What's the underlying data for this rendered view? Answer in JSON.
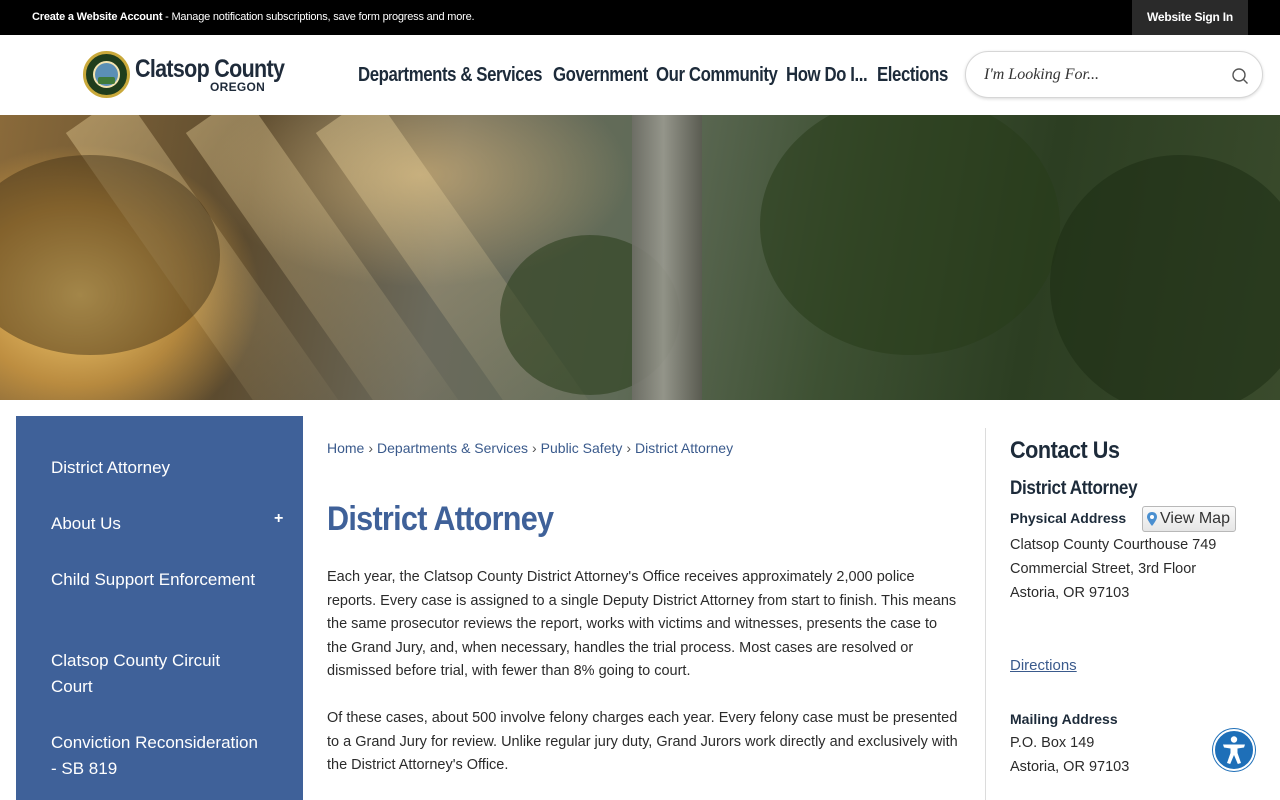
{
  "topbar": {
    "create_account": "Create a Website Account",
    "create_account_desc": " - Manage notification subscriptions, save form progress and more.",
    "sign_in": "Website Sign In"
  },
  "header": {
    "logo_name": "Clatsop County",
    "logo_sub": "OREGON",
    "nav": [
      "Departments & Services",
      "Government",
      "Our Community",
      "How Do I...",
      "Elections"
    ],
    "search_placeholder": "I'm Looking For..."
  },
  "sidebar": {
    "items": [
      "District Attorney",
      "About Us",
      "Child Support Enforcement",
      "Clatsop County Circuit Court",
      "Conviction Reconsideration - SB 819"
    ],
    "toggle": "+"
  },
  "breadcrumb": [
    "Home",
    "Departments & Services",
    "Public Safety",
    "District Attorney"
  ],
  "breadcrumb_sep": "›",
  "main": {
    "title": "District Attorney",
    "paragraphs": [
      "Each year, the Clatsop County District Attorney's Office receives approximately 2,000 police reports. Every case is assigned to a single Deputy District Attorney from start to finish. This means the same prosecutor reviews the report, works with victims and witnesses, presents the case to the Grand Jury, and, when necessary, handles the trial process. Most cases are resolved or dismissed before trial, with fewer than 8% going to court.",
      "Of these cases, about 500 involve felony charges each year. Every felony case must be presented to a Grand Jury for review. Unlike regular jury duty, Grand Jurors work directly and exclusively with the District Attorney's Office."
    ]
  },
  "contact": {
    "heading": "Contact Us",
    "org": "District Attorney",
    "physical_label": "Physical Address",
    "view_map": "View Map",
    "physical_lines": [
      "Clatsop County Courthouse 749",
      "Commercial Street, 3rd Floor",
      "Astoria, OR 97103"
    ],
    "directions": "Directions",
    "mailing_label": "Mailing Address",
    "mailing_lines": [
      "P.O. Box 149",
      "Astoria, OR 97103"
    ]
  },
  "colors": {
    "sidebar_bg": "#3f6199",
    "title": "#3f6199",
    "link": "#3a5a8c",
    "accessibility": "#1e6fb8"
  }
}
